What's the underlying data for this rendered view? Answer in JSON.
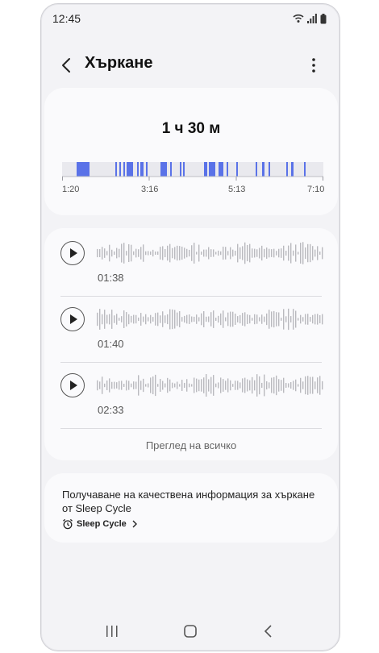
{
  "status_bar": {
    "time": "12:45",
    "icons": [
      "wifi-icon",
      "signal-icon",
      "battery-icon"
    ]
  },
  "header": {
    "title": "Хъркане",
    "back_icon": "back-arrow-icon",
    "more_icon": "more-vert-icon"
  },
  "summary": {
    "duration": "1 ч 30 м",
    "ticks": [
      "1:20",
      "3:16",
      "5:13",
      "7:10"
    ],
    "accent_color": "#5a72e8",
    "track_color": "#e9e9ee"
  },
  "recordings": [
    {
      "time": "01:38",
      "play_icon": "play-icon"
    },
    {
      "time": "01:40",
      "play_icon": "play-icon"
    },
    {
      "time": "02:33",
      "play_icon": "play-icon"
    }
  ],
  "view_all_label": "Преглед на всичко",
  "sleep_cycle": {
    "text": "Получаване на качествена информация за хъркане от Sleep Cycle",
    "link_label": "Sleep Cycle",
    "icon": "alarm-clock-icon"
  },
  "nav": [
    "recent-apps-icon",
    "home-icon",
    "back-icon"
  ]
}
